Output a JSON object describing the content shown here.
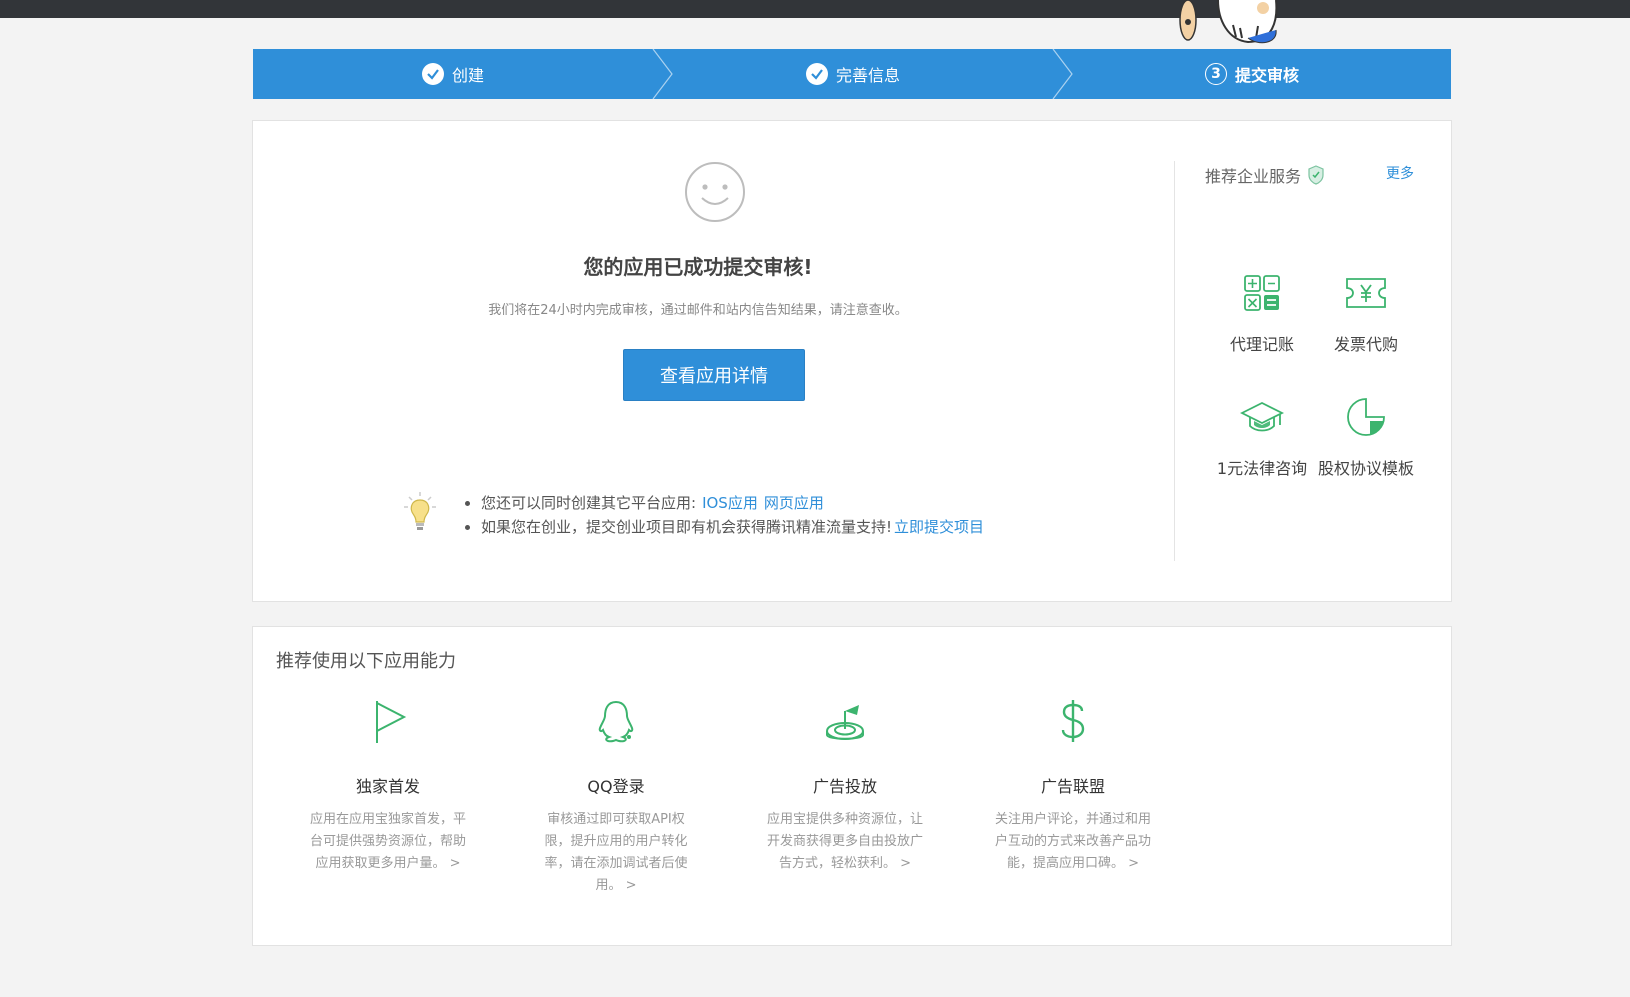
{
  "steps": [
    {
      "label": "创建",
      "state": "done"
    },
    {
      "label": "完善信息",
      "state": "done"
    },
    {
      "label": "提交审核",
      "state": "active",
      "number": "3"
    }
  ],
  "success": {
    "title": "您的应用已成功提交审核!",
    "description": "我们将在24小时内完成审核，通过邮件和站内信告知结果，请注意查收。",
    "button_label": "查看应用详情"
  },
  "tips": {
    "line1_text": "您还可以同时创建其它平台应用:",
    "line1_links": [
      "IOS应用",
      "网页应用"
    ],
    "line2_text": "如果您在创业，提交创业项目即有机会获得腾讯精准流量支持!",
    "line2_link": "立即提交项目"
  },
  "services": {
    "title": "推荐企业服务",
    "more": "更多",
    "items": [
      {
        "label": "代理记账",
        "icon": "calculator-icon"
      },
      {
        "label": "发票代购",
        "icon": "ticket-yen-icon"
      },
      {
        "label": "1元法律咨询",
        "icon": "graduation-cap-icon"
      },
      {
        "label": "股权协议模板",
        "icon": "pie-chart-icon"
      }
    ]
  },
  "capabilities": {
    "title": "推荐使用以下应用能力",
    "items": [
      {
        "name": "独家首发",
        "desc": "应用在应用宝独家首发，平台可提供强势资源位，帮助应用获取更多用户量。 >",
        "icon": "flag-icon"
      },
      {
        "name": "QQ登录",
        "desc": "审核通过即可获取API权限，提升应用的用户转化率，请在添加调试者后使用。 >",
        "icon": "qq-penguin-icon"
      },
      {
        "name": "广告投放",
        "desc": "应用宝提供多种资源位，让开发商获得更多自由投放广告方式，轻松获利。 >",
        "icon": "target-icon"
      },
      {
        "name": "广告联盟",
        "desc": "关注用户评论，并通过和用户互动的方式来改善产品功能，提高应用口碑。 >",
        "icon": "dollar-icon"
      }
    ]
  },
  "colors": {
    "accent": "#2f8fd9",
    "icon_green": "#3cb46e",
    "topbar": "#323539"
  }
}
